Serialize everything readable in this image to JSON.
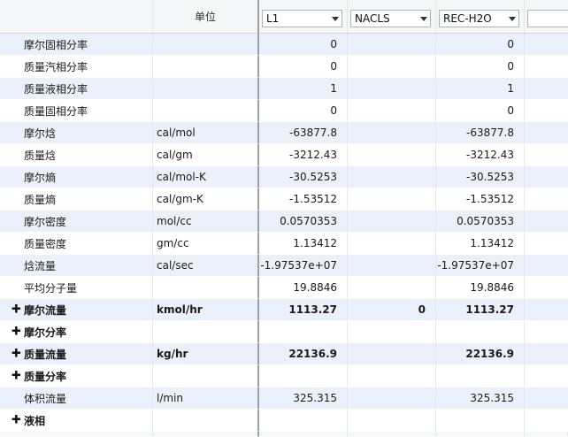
{
  "header": {
    "unit_label": "单位",
    "streams": [
      {
        "name": "L1"
      },
      {
        "name": "NACLS"
      },
      {
        "name": "REC-H2O"
      },
      {
        "name": ""
      }
    ]
  },
  "rows": [
    {
      "name": "摩尔固相分率",
      "unit": "",
      "values": [
        "0",
        "",
        "0"
      ],
      "expandable": false,
      "bold": false
    },
    {
      "name": "质量汽相分率",
      "unit": "",
      "values": [
        "0",
        "",
        "0"
      ],
      "expandable": false,
      "bold": false
    },
    {
      "name": "质量液相分率",
      "unit": "",
      "values": [
        "1",
        "",
        "1"
      ],
      "expandable": false,
      "bold": false
    },
    {
      "name": "质量固相分率",
      "unit": "",
      "values": [
        "0",
        "",
        "0"
      ],
      "expandable": false,
      "bold": false
    },
    {
      "name": "摩尔焓",
      "unit": "cal/mol",
      "values": [
        "-63877.8",
        "",
        "-63877.8"
      ],
      "expandable": false,
      "bold": false
    },
    {
      "name": "质量焓",
      "unit": "cal/gm",
      "values": [
        "-3212.43",
        "",
        "-3212.43"
      ],
      "expandable": false,
      "bold": false
    },
    {
      "name": "摩尔熵",
      "unit": "cal/mol-K",
      "values": [
        "-30.5253",
        "",
        "-30.5253"
      ],
      "expandable": false,
      "bold": false
    },
    {
      "name": "质量熵",
      "unit": "cal/gm-K",
      "values": [
        "-1.53512",
        "",
        "-1.53512"
      ],
      "expandable": false,
      "bold": false
    },
    {
      "name": "摩尔密度",
      "unit": "mol/cc",
      "values": [
        "0.0570353",
        "",
        "0.0570353"
      ],
      "expandable": false,
      "bold": false
    },
    {
      "name": "质量密度",
      "unit": "gm/cc",
      "values": [
        "1.13412",
        "",
        "1.13412"
      ],
      "expandable": false,
      "bold": false
    },
    {
      "name": "焓流量",
      "unit": "cal/sec",
      "values": [
        "-1.97537e+07",
        "",
        "-1.97537e+07"
      ],
      "expandable": false,
      "bold": false
    },
    {
      "name": "平均分子量",
      "unit": "",
      "values": [
        "19.8846",
        "",
        "19.8846"
      ],
      "expandable": false,
      "bold": false
    },
    {
      "name": "摩尔流量",
      "unit": "kmol/hr",
      "values": [
        "1113.27",
        "0",
        "1113.27"
      ],
      "expandable": true,
      "bold": true
    },
    {
      "name": "摩尔分率",
      "unit": "",
      "values": [
        "",
        "",
        ""
      ],
      "expandable": true,
      "bold": true
    },
    {
      "name": "质量流量",
      "unit": "kg/hr",
      "values": [
        "22136.9",
        "",
        "22136.9"
      ],
      "expandable": true,
      "bold": true
    },
    {
      "name": "质量分率",
      "unit": "",
      "values": [
        "",
        "",
        ""
      ],
      "expandable": true,
      "bold": true
    },
    {
      "name": "体积流量",
      "unit": "l/min",
      "values": [
        "325.315",
        "",
        "325.315"
      ],
      "expandable": false,
      "bold": false
    },
    {
      "name": "液相",
      "unit": "",
      "values": [
        "",
        "",
        ""
      ],
      "expandable": true,
      "bold": true
    }
  ],
  "icons": {
    "expand": "plus-icon",
    "dropdown": "chevron-down-icon"
  },
  "colors": {
    "row_alt": "#eaf1fb",
    "header_bg": "#f4f6f8"
  }
}
